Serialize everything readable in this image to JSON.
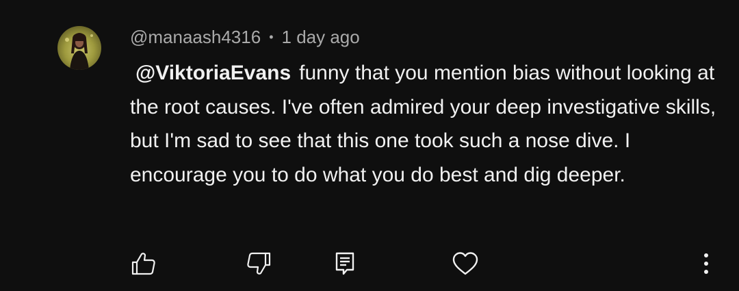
{
  "comment": {
    "author_handle": "@manaash4316",
    "separator": "•",
    "timestamp": "1 day ago",
    "mention": "@ViktoriaEvans",
    "text": "funny that you mention bias without looking at the root causes. I've often admired your deep investigative skills, but I'm sad to see that this one took such a nose dive. I encourage you to do what you do best and dig deeper."
  },
  "actions": {
    "like_icon": "thumbs-up-icon",
    "dislike_icon": "thumbs-down-icon",
    "reply_icon": "reply-comment-icon",
    "heart_icon": "heart-icon",
    "more_icon": "more-vertical-icon"
  },
  "colors": {
    "background": "#0f0f0f",
    "text_primary": "#f1f1f1",
    "text_secondary": "#aaaaaa"
  }
}
